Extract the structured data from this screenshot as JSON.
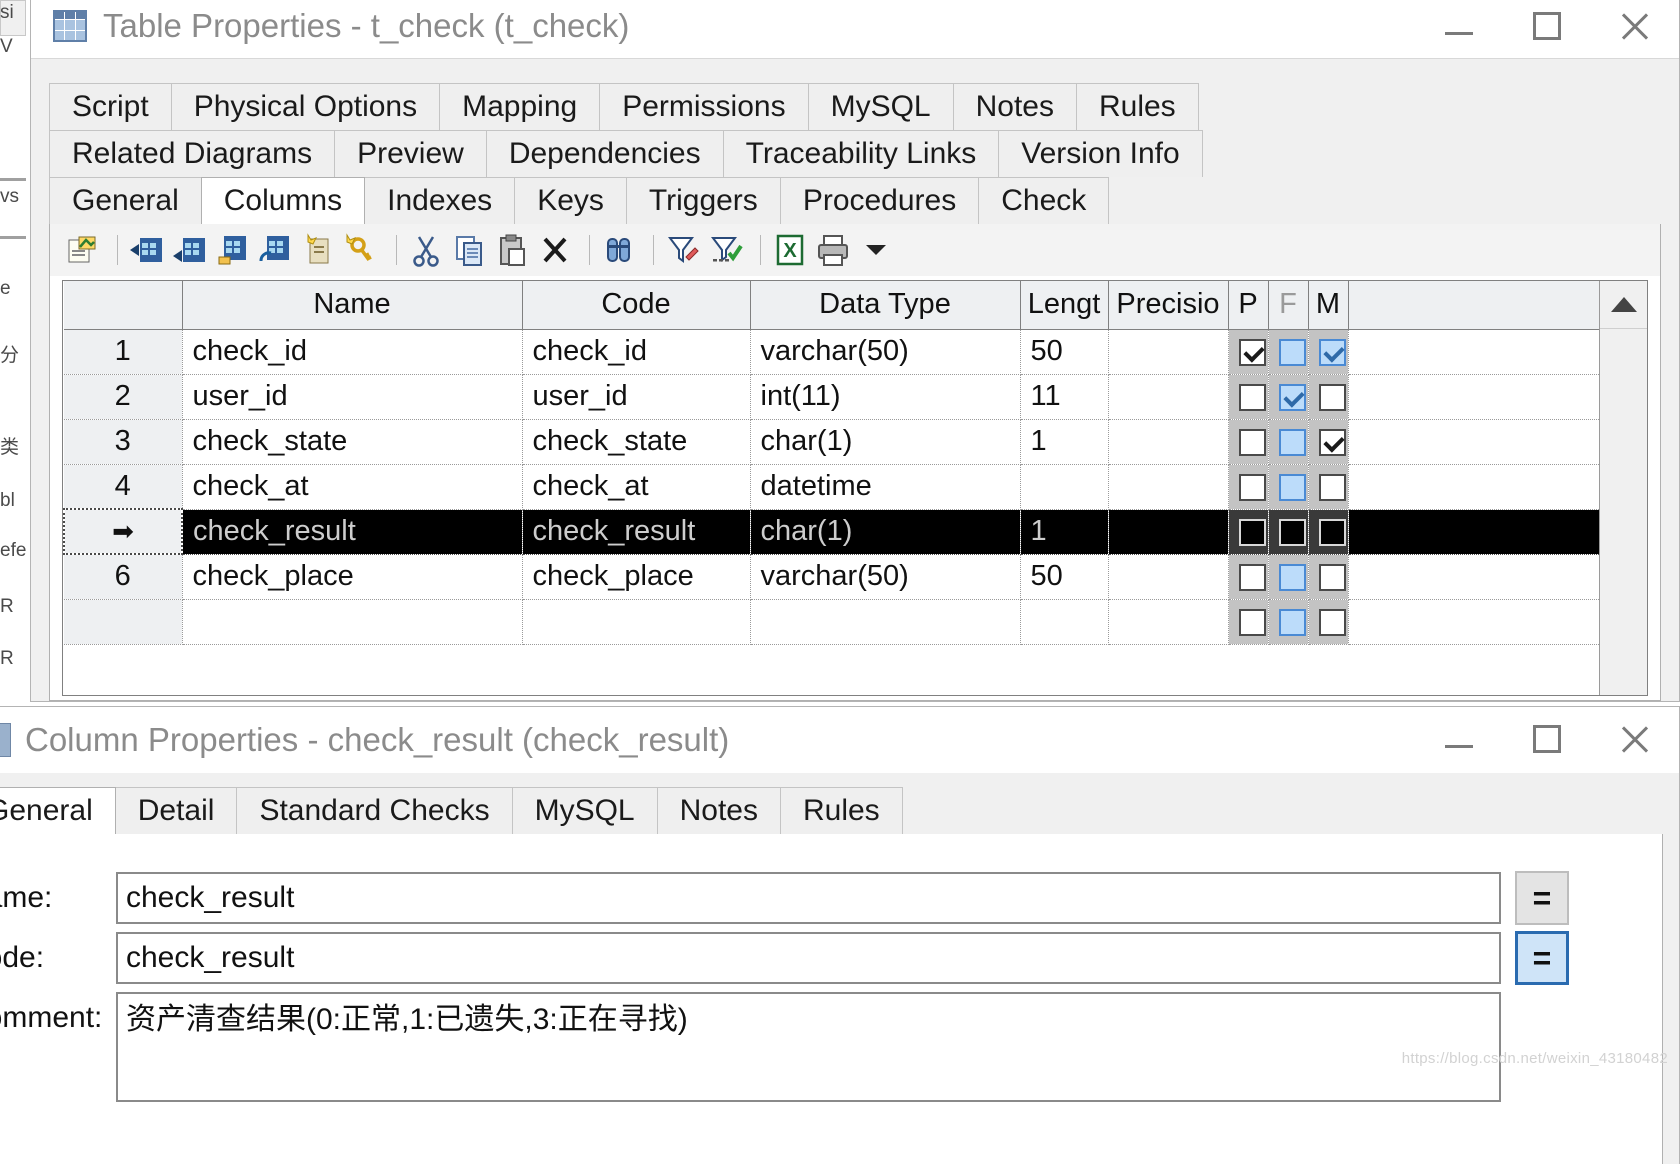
{
  "table_window": {
    "title": "Table Properties - t_check (t_check)",
    "icon": "table-grid-icon",
    "minimize_label": "Minimize",
    "maximize_label": "Maximize",
    "close_label": "Close",
    "tab_rows": [
      [
        "Script",
        "Physical Options",
        "Mapping",
        "Permissions",
        "MySQL",
        "Notes",
        "Rules"
      ],
      [
        "Related Diagrams",
        "Preview",
        "Dependencies",
        "Traceability Links",
        "Version Info"
      ],
      [
        "General",
        "Columns",
        "Indexes",
        "Keys",
        "Triggers",
        "Procedures",
        "Check"
      ]
    ],
    "selected_tab": "Columns",
    "toolbar_icons": [
      "properties-icon",
      "sep",
      "insert-row-icon",
      "add-row-icon",
      "add-column-icon",
      "replace-column-icon",
      "new-object-icon",
      "new-key-icon",
      "sep",
      "cut-icon",
      "copy-icon",
      "paste-icon",
      "delete-icon",
      "sep",
      "find-icon",
      "sep",
      "filter-icon",
      "apply-filter-icon",
      "sep",
      "export-excel-icon",
      "print-icon",
      "dropdown-arrow-icon"
    ],
    "grid": {
      "headers": [
        "",
        "Name",
        "Code",
        "Data Type",
        "Lengt",
        "Precisio",
        "P",
        "F",
        "M"
      ],
      "dim_headers": [
        "F"
      ],
      "rows": [
        {
          "num": "1",
          "name": "check_id",
          "code": "check_id",
          "type": "varchar(50)",
          "length": "50",
          "precision": "",
          "p": "checked",
          "f": "blue",
          "m": "blue-checked",
          "selected": false
        },
        {
          "num": "2",
          "name": "user_id",
          "code": "user_id",
          "type": "int(11)",
          "length": "11",
          "precision": "",
          "p": "unchecked",
          "f": "blue-checked",
          "m": "unchecked",
          "selected": false
        },
        {
          "num": "3",
          "name": "check_state",
          "code": "check_state",
          "type": "char(1)",
          "length": "1",
          "precision": "",
          "p": "unchecked",
          "f": "blue",
          "m": "checked",
          "selected": false
        },
        {
          "num": "4",
          "name": "check_at",
          "code": "check_at",
          "type": "datetime",
          "length": "",
          "precision": "",
          "p": "unchecked",
          "f": "blue",
          "m": "unchecked",
          "selected": false
        },
        {
          "num": "➡",
          "name": "check_result",
          "code": "check_result",
          "type": "char(1)",
          "length": "1",
          "precision": "",
          "p": "black",
          "f": "black",
          "m": "black",
          "selected": true
        },
        {
          "num": "6",
          "name": "check_place",
          "code": "check_place",
          "type": "varchar(50)",
          "length": "50",
          "precision": "",
          "p": "unchecked",
          "f": "blue",
          "m": "unchecked",
          "selected": false
        },
        {
          "num": "",
          "name": "",
          "code": "",
          "type": "",
          "length": "",
          "precision": "",
          "p": "unchecked",
          "f": "blue",
          "m": "unchecked",
          "selected": false
        }
      ],
      "scroll_up_icon": "caret-up-icon"
    }
  },
  "column_window": {
    "title": "Column Properties - check_result (check_result)",
    "icon": "column-icon",
    "minimize_label": "Minimize",
    "maximize_label": "Maximize",
    "close_label": "Close",
    "tabs": [
      "General",
      "Detail",
      "Standard Checks",
      "MySQL",
      "Notes",
      "Rules"
    ],
    "selected_tab": "General",
    "fields": {
      "name_label": "Name:",
      "name_value": "check_result",
      "code_label": "Code:",
      "code_value": "check_result",
      "comment_label": "Comment:",
      "comment_value": "资产清查结果(0:正常,1:已遗失,3:正在寻找)",
      "eq_button_label": "=",
      "eq_button_active_label": "="
    }
  },
  "background": {
    "fragments": [
      "si",
      "V",
      "vs",
      "e",
      "分",
      "类",
      "bl",
      "efe",
      "R",
      "R"
    ]
  },
  "watermark": "https://blog.csdn.net/weixin_43180482"
}
